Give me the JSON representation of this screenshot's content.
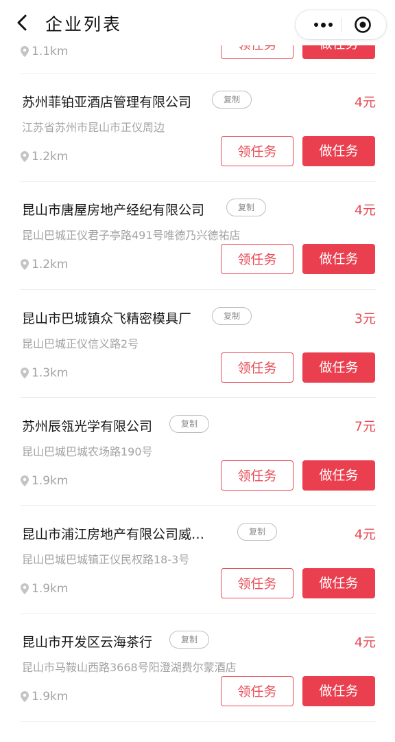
{
  "header": {
    "title": "企业列表",
    "back_icon": "chevron-left-icon",
    "more_icon": "more-dots-icon",
    "close_icon": "target-circle-icon"
  },
  "partial_top": {
    "distance": "1.1km",
    "claim_label": "领任务",
    "do_label": "做任务"
  },
  "items": [
    {
      "name": "苏州菲铂亚酒店管理有限公司",
      "copy": "复制",
      "price": "4元",
      "address": "江苏省苏州市昆山市正仪周边",
      "distance": "1.2km",
      "claim_label": "领任务",
      "do_label": "做任务"
    },
    {
      "name": "昆山市唐屋房地产经纪有限公司",
      "copy": "复制",
      "price": "4元",
      "address": "昆山巴城正仪君子亭路491号唯德乃兴德祐店",
      "distance": "1.2km",
      "claim_label": "领任务",
      "do_label": "做任务"
    },
    {
      "name": "昆山市巴城镇众飞精密模具厂",
      "copy": "复制",
      "price": "3元",
      "address": "昆山巴城正仪信义路2号",
      "distance": "1.3km",
      "claim_label": "领任务",
      "do_label": "做任务"
    },
    {
      "name": "苏州辰瓴光学有限公司",
      "copy": "复制",
      "price": "7元",
      "address": "昆山巴城巴城农场路190号",
      "distance": "1.9km",
      "claim_label": "领任务",
      "do_label": "做任务"
    },
    {
      "name": "昆山市浦江房地产有限公司威…",
      "copy": "复制",
      "price": "4元",
      "address": "昆山巴城巴城镇正仪民权路18-3号",
      "distance": "1.9km",
      "claim_label": "领任务",
      "do_label": "做任务"
    },
    {
      "name": "昆山市开发区云海茶行",
      "copy": "复制",
      "price": "4元",
      "address": "昆山市马鞍山西路3668号阳澄湖费尔蒙酒店",
      "distance": "1.9km",
      "claim_label": "领任务",
      "do_label": "做任务"
    }
  ],
  "colors": {
    "accent": "#ea3f4e",
    "muted": "#a3a3a3"
  }
}
